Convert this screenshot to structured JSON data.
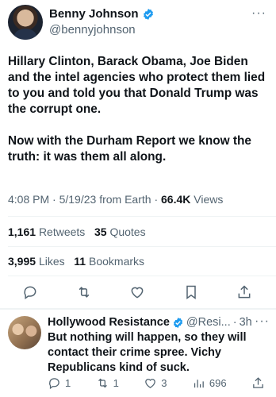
{
  "tweet": {
    "display_name": "Benny Johnson",
    "handle": "@bennyjohnson",
    "text": "Hillary Clinton, Barack Obama, Joe Biden and the intel agencies who protect them lied to you and told you that Donald Trump was the corrupt one.\n\nNow with the Durham Report we know the truth: it was them all along.",
    "time": "4:08 PM",
    "date": "5/19/23",
    "source": "from Earth",
    "views_count": "66.4K",
    "views_label": "Views",
    "retweets_count": "1,161",
    "retweets_label": "Retweets",
    "quotes_count": "35",
    "quotes_label": "Quotes",
    "likes_count": "3,995",
    "likes_label": "Likes",
    "bookmarks_count": "11",
    "bookmarks_label": "Bookmarks"
  },
  "reply": {
    "display_name": "Hollywood Resistance",
    "handle": "@Resi...",
    "age": "3h",
    "text": "But nothing will happen, so they will contact their crime spree. Vichy Republicans kind of suck.",
    "replies": "1",
    "retweets": "1",
    "likes": "3",
    "views": "696"
  },
  "icons": {
    "verified": "verified-badge-icon",
    "more": "more-options-icon",
    "reply": "reply-icon",
    "retweet": "retweet-icon",
    "like": "heart-icon",
    "bookmark": "bookmark-icon",
    "share": "share-icon",
    "views": "views-chart-icon"
  },
  "colors": {
    "verified_blue": "#1d9bf0",
    "secondary_text": "#536471",
    "primary_text": "#0f1419"
  }
}
